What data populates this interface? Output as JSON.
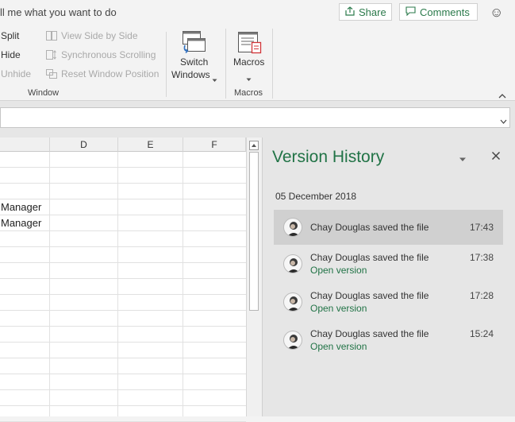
{
  "topbar": {
    "tell_me": "ll me what you want to do",
    "share_label": "Share",
    "comments_label": "Comments",
    "smiley": "☺"
  },
  "ribbon": {
    "window_group": {
      "split_label": "Split",
      "hide_label": "Hide",
      "unhide_label": "Unhide",
      "view_side_by_side_label": "View Side by Side",
      "sync_scrolling_label": "Synchronous Scrolling",
      "reset_position_label": "Reset Window Position",
      "switch_windows_line1": "Switch",
      "switch_windows_line2": "Windows",
      "group_label": "Window"
    },
    "macros_group": {
      "macros_label": "Macros",
      "group_label": "Macros"
    }
  },
  "grid": {
    "columns": [
      "D",
      "E",
      "F"
    ],
    "cells": [
      {
        "row": 4,
        "text": "Manager"
      },
      {
        "row": 5,
        "text": "Manager"
      }
    ]
  },
  "version_history": {
    "title": "Version History",
    "date": "05 December 2018",
    "items": [
      {
        "text": "Chay Douglas saved the file",
        "time": "17:43",
        "link": ""
      },
      {
        "text": "Chay Douglas saved the file",
        "time": "17:38",
        "link": "Open version"
      },
      {
        "text": "Chay Douglas saved the file",
        "time": "17:28",
        "link": "Open version"
      },
      {
        "text": "Chay Douglas saved the file",
        "time": "15:24",
        "link": "Open version"
      }
    ]
  },
  "colors": {
    "accent": "#217346",
    "panel_bg": "#e6e6e6",
    "selected_item_bg": "#d0d0d0"
  }
}
